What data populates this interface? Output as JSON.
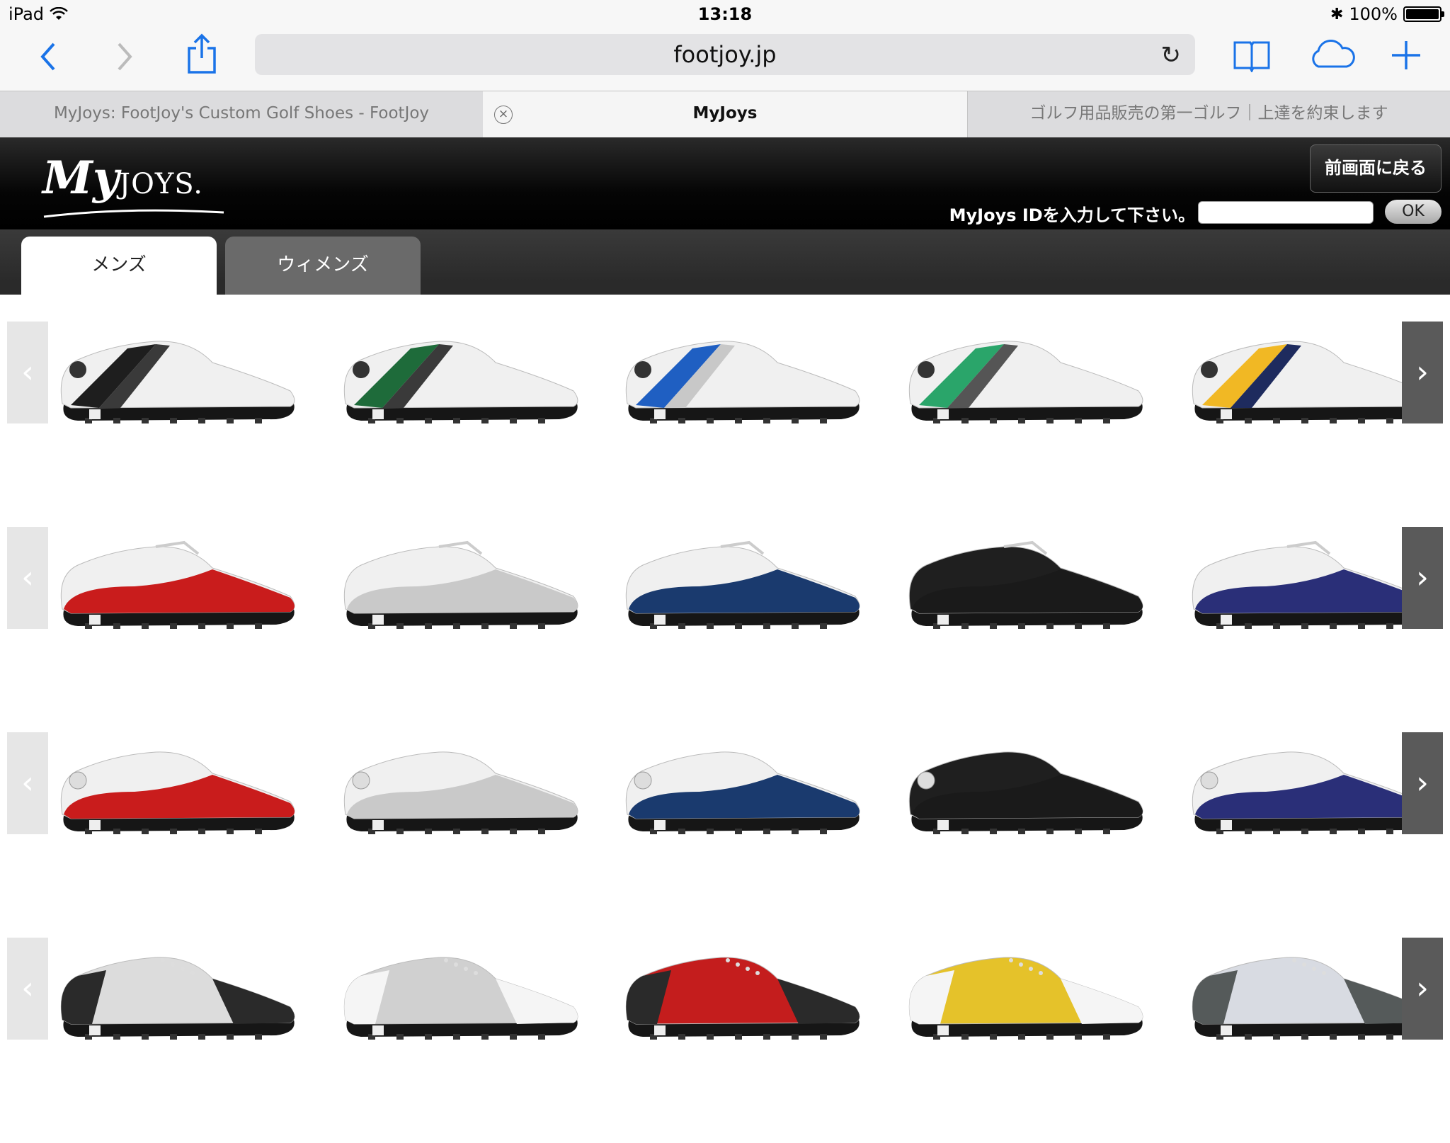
{
  "status": {
    "device": "iPad",
    "time": "13:18",
    "battery": "100%",
    "battery_level": 1.0
  },
  "toolbar": {
    "url": "footjoy.jp"
  },
  "tabs": [
    {
      "label": "MyJoys: FootJoy's Custom Golf Shoes - FootJoy",
      "active": false
    },
    {
      "label": "MyJoys",
      "active": true
    },
    {
      "label": "ゴルフ用品販売の第一ゴルフ｜上達を約束します",
      "active": false
    }
  ],
  "header": {
    "logo_script": "My",
    "logo_caps": "JOYS.",
    "back_label": "前画面に戻る",
    "id_label": "MyJoys IDを入力して下さい。",
    "id_value": "",
    "ok_label": "OK"
  },
  "categories": [
    {
      "label": "メンズ",
      "active": true
    },
    {
      "label": "ウィメンズ",
      "active": false
    }
  ],
  "nav": {
    "prev": "‹",
    "next": "›"
  },
  "colors": {
    "white": "#f2f2f2",
    "black": "#1c1c1c",
    "sole": "#161616"
  },
  "rows": [
    {
      "style": "boa-saddle",
      "shoes": [
        {
          "primary": "#f0f0f0",
          "accent": "#1e1e1e",
          "stripe": "#3a3a3a"
        },
        {
          "primary": "#f0f0f0",
          "accent": "#1e6b3a",
          "stripe": "#3a3a3a"
        },
        {
          "primary": "#f0f0f0",
          "accent": "#1f5fc2",
          "stripe": "#c8c8c8"
        },
        {
          "primary": "#f0f0f0",
          "accent": "#2aa56a",
          "stripe": "#555555"
        },
        {
          "primary": "#f0f0f0",
          "accent": "#f1b824",
          "stripe": "#1e2b5e"
        }
      ]
    },
    {
      "style": "lace",
      "shoes": [
        {
          "primary": "#f0f0f0",
          "accent": "#c91c1c"
        },
        {
          "primary": "#f0f0f0",
          "accent": "#c9c9c9"
        },
        {
          "primary": "#f0f0f0",
          "accent": "#1a3a6e"
        },
        {
          "primary": "#1f1f1f",
          "accent": "#1a1a1a"
        },
        {
          "primary": "#f0f0f0",
          "accent": "#2a2f78"
        }
      ]
    },
    {
      "style": "boa",
      "shoes": [
        {
          "primary": "#f0f0f0",
          "accent": "#c91c1c"
        },
        {
          "primary": "#f0f0f0",
          "accent": "#c9c9c9"
        },
        {
          "primary": "#f0f0f0",
          "accent": "#1a3a6e"
        },
        {
          "primary": "#1f1f1f",
          "accent": "#1a1a1a"
        },
        {
          "primary": "#f0f0f0",
          "accent": "#2a2f78"
        }
      ]
    },
    {
      "style": "saddle",
      "shoes": [
        {
          "primary": "#dcdcdc",
          "accent": "#2a2a2a"
        },
        {
          "primary": "#d0d0d0",
          "accent": "#f5f5f5"
        },
        {
          "primary": "#c41d1d",
          "accent": "#2a2a2a"
        },
        {
          "primary": "#e5c22a",
          "accent": "#f5f5f5"
        },
        {
          "primary": "#d8dbe2",
          "accent": "#555a5a"
        }
      ]
    }
  ]
}
